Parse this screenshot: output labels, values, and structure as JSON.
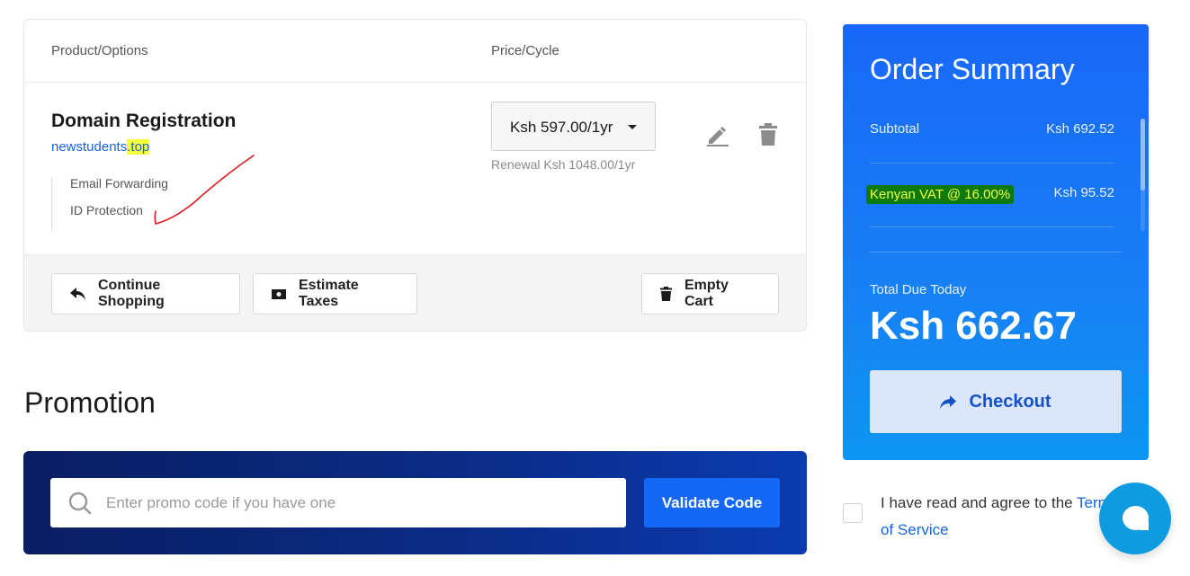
{
  "cart": {
    "header": {
      "product_col": "Product/Options",
      "price_col": "Price/Cycle"
    },
    "item": {
      "title": "Domain Registration",
      "domain_base": "newstudents",
      "domain_tld": ".top",
      "addons": [
        "Email Forwarding",
        "ID Protection"
      ],
      "price_cycle": "Ksh 597.00/1yr",
      "renewal": "Renewal Ksh 1048.00/1yr"
    },
    "buttons": {
      "continue_shopping": "Continue Shopping",
      "estimate_taxes": "Estimate Taxes",
      "empty_cart": "Empty Cart"
    }
  },
  "promotion": {
    "title": "Promotion",
    "placeholder": "Enter promo code if you have one",
    "validate": "Validate Code"
  },
  "summary": {
    "title": "Order Summary",
    "subtotal_label": "Subtotal",
    "subtotal_value": "Ksh 692.52",
    "vat_label": "Kenyan VAT @ 16.00%",
    "vat_value": "Ksh 95.52",
    "total_label": "Total Due Today",
    "total_value": "Ksh 662.67",
    "checkout": "Checkout"
  },
  "terms": {
    "text": "I have read and agree to the ",
    "link": "Terms of Service"
  },
  "icons": {
    "continue": "reply-arrow-icon",
    "estimate": "money-bill-icon",
    "empty": "trash-icon",
    "edit": "pencil-icon",
    "remove": "trash-icon",
    "search": "search-icon",
    "checkout": "share-arrow-icon",
    "chat": "chat-bubble-icon"
  },
  "colors": {
    "brand_blue": "#1568f5",
    "link_blue": "#1565d8",
    "highlight_yellow": "#f6ff3d",
    "vat_highlight_bg": "#0c7a0c",
    "promo_navy": "#0a1e63"
  }
}
